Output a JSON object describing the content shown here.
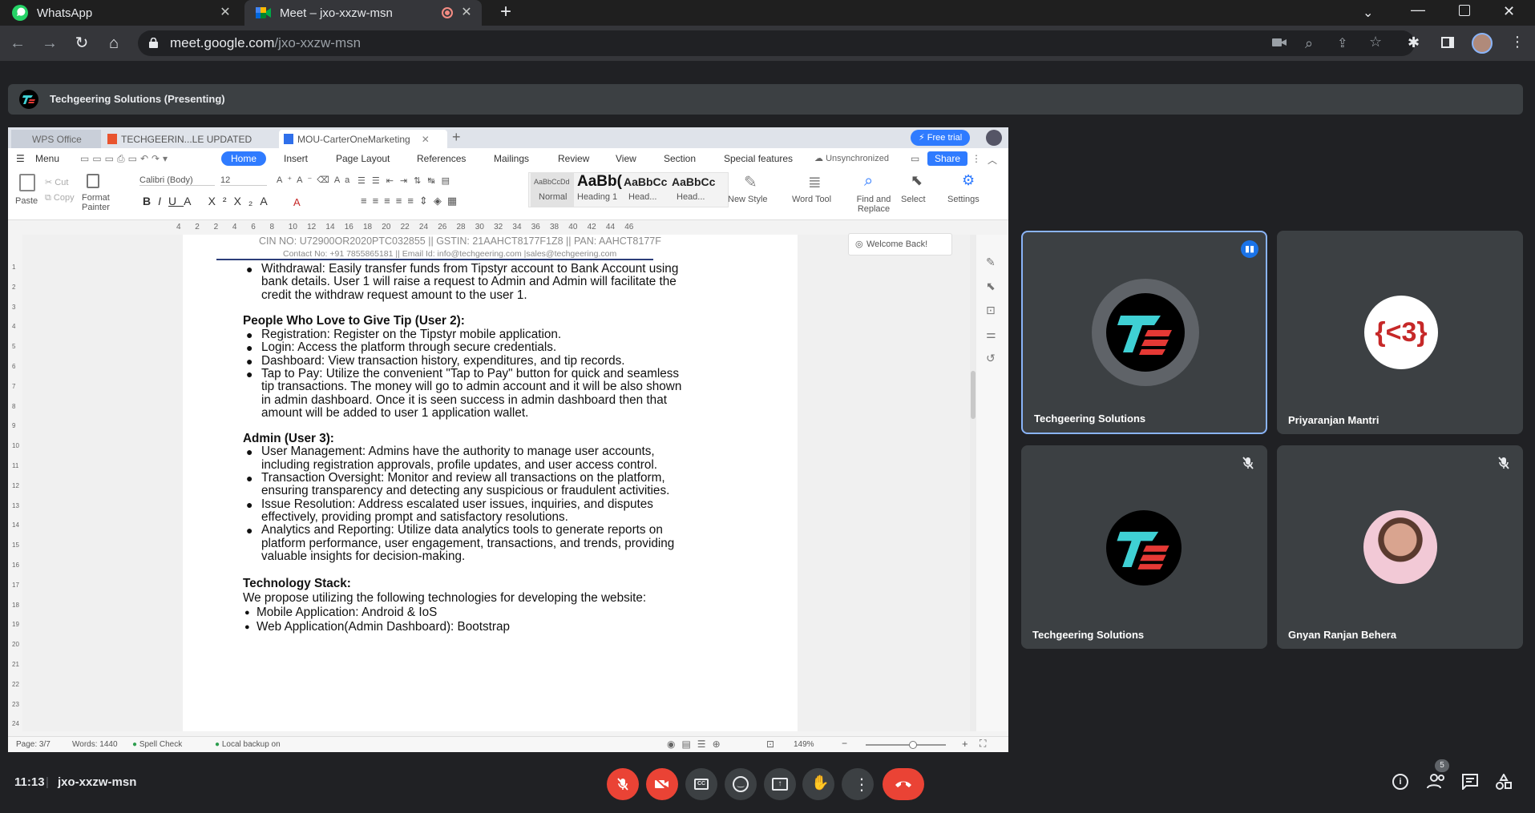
{
  "browser": {
    "tabs": [
      {
        "label": "WhatsApp",
        "icon": "whatsapp-icon"
      },
      {
        "label": "Meet – jxo-xxzw-msn",
        "icon": "meet-icon",
        "active": true
      }
    ],
    "url_host": "meet.google.com",
    "url_path": "/jxo-xxzw-msn"
  },
  "meet": {
    "presenting_label": "Techgeering Solutions (Presenting)",
    "time": "11:13",
    "meeting_code": "jxo-xxzw-msn",
    "people_count": "5",
    "participants": [
      {
        "name": "Techgeering Solutions",
        "speaking": true
      },
      {
        "name": "Priyaranjan Mantri",
        "avatar_text": "{<3}"
      },
      {
        "name": "Techgeering Solutions",
        "muted": true
      },
      {
        "name": "Gnyan Ranjan Behera",
        "muted": true
      }
    ],
    "colors": {
      "end_call": "#ea4335",
      "mic_off": "#ea4335",
      "accent": "#8ab4f8"
    }
  },
  "wps": {
    "tabs": [
      "WPS Office",
      "TECHGEERIN...LE UPDATED",
      "MOU-CarterOneMarketing"
    ],
    "free_trial": "Free trial",
    "menu": [
      "Menu",
      "Home",
      "Insert",
      "Page Layout",
      "References",
      "Mailings",
      "Review",
      "View",
      "Section",
      "Special features"
    ],
    "unsynchronized": "Unsynchronized",
    "share": "Share",
    "paste": "Paste",
    "cut": "Cut",
    "copy": "Copy",
    "format_painter": "Format Painter",
    "font": "Calibri (Body)",
    "font_size": "12",
    "styles": [
      {
        "preview": "AaBbCcDd",
        "label": "Normal"
      },
      {
        "preview": "AaBb(",
        "label": "Heading 1"
      },
      {
        "preview": "AaBbCc",
        "label": "Head..."
      },
      {
        "preview": "AaBbCc",
        "label": "Head..."
      }
    ],
    "new_style": "New Style",
    "word_tool": "Word Tool",
    "find_replace": "Find and Replace",
    "select": "Select",
    "settings": "Settings",
    "welcome": "Welcome Back!",
    "ruler_ticks": [
      "4",
      "2",
      "2",
      "4",
      "6",
      "8",
      "10",
      "12",
      "14",
      "16",
      "18",
      "20",
      "22",
      "24",
      "26",
      "28",
      "30",
      "32",
      "34",
      "36",
      "38",
      "40",
      "42",
      "44",
      "46"
    ],
    "vruler_ticks": [
      "1",
      "2",
      "3",
      "4",
      "5",
      "6",
      "7",
      "8",
      "9",
      "10",
      "11",
      "12",
      "13",
      "14",
      "15",
      "16",
      "17",
      "18",
      "19",
      "20",
      "21",
      "22",
      "23",
      "24"
    ],
    "status": {
      "page": "Page: 3/7",
      "words": "Words: 1440",
      "spell": "Spell Check",
      "backup": "Local backup on",
      "zoom": "149%"
    }
  },
  "doc": {
    "header1": "CIN NO: U72900OR2020PTC032855 || GSTIN: 21AAHCT8177F1Z8 || PAN: AAHCT8177F",
    "header2": "Contact No: +91 7855865181 || Email Id: info@techgeering.com |sales@techgeering.com",
    "withdrawal": [
      "Withdrawal: Easily transfer funds from Tipstyr account to Bank Account using",
      "bank details.  User 1 will raise a request to Admin and Admin will facilitate the",
      "credit the withdraw request amount to the user 1."
    ],
    "user2_heading": "People Who Love to Give Tip (User 2):",
    "user2_items": [
      "Registration: Register on the Tipstyr mobile application.",
      "Login: Access the platform through secure credentials.",
      "Dashboard: View transaction history, expenditures, and tip records."
    ],
    "tap_to_pay": [
      "Tap to Pay: Utilize the convenient \"Tap to Pay\" button for quick and seamless",
      "tip transactions. The money will go to admin account and it will be also shown",
      "in admin dashboard. Once it is seen success in admin dashboard then that",
      "amount will be added to user 1 application wallet."
    ],
    "admin_heading": "Admin (User 3):",
    "admin_items": [
      [
        "User Management: Admins have the authority to manage user accounts,",
        "including registration approvals, profile updates, and user access control."
      ],
      [
        "Transaction Oversight: Monitor and review all transactions on the platform,",
        "ensuring transparency and detecting any suspicious or fraudulent activities."
      ],
      [
        "Issue Resolution: Address escalated user issues, inquiries, and disputes",
        "effectively, providing prompt and satisfactory resolutions."
      ],
      [
        "Analytics and Reporting: Utilize data analytics tools to generate reports on",
        "platform performance, user engagement, transactions, and trends, providing",
        "valuable insights for decision-making."
      ]
    ],
    "tech_heading": "Technology Stack:",
    "tech_intro": "We propose utilizing the following technologies for developing the website:",
    "tech_items": [
      "Mobile Application: Android & IoS",
      "Web Application(Admin Dashboard): Bootstrap"
    ]
  }
}
